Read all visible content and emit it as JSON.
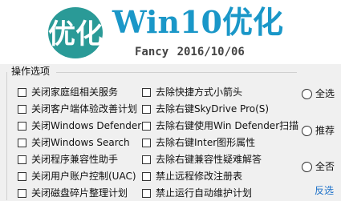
{
  "header": {
    "title": "Win10优化",
    "subtitle": "Fancy  2016/10/06",
    "logo_text": "优化",
    "accent_color": "#1a97c8",
    "logo_color": "#2a9a97"
  },
  "group": {
    "label": "操作选项"
  },
  "left_options": [
    "关闭家庭组相关服务",
    "关闭客户端体验改善计划",
    "关闭Windows Defender",
    "关闭Windows Search",
    "关闭程序兼容性助手",
    "关闭用户账户控制(UAC)",
    "关闭磁盘碎片整理计划"
  ],
  "right_options": [
    "去除快捷方式小箭头",
    "去除右键SkyDrive Pro(S)",
    "去除右键使用Win Defender扫描",
    "去除右键Inter图形属性",
    "去除右键兼容性疑难解答",
    "禁止远程修改注册表",
    "禁止运行自动维护计划"
  ],
  "radio_options": [
    "全选",
    "推荐",
    "全否"
  ],
  "link_text": "反选"
}
